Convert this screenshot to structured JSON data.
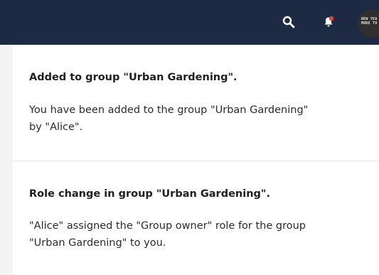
{
  "header": {
    "search_icon": "search-icon",
    "notification_icon": "bell-icon",
    "notification_dot_color": "#e0473c",
    "avatar_text": "NEW YEA\nMORE TO"
  },
  "notifications": [
    {
      "title": "Added to group \"Urban Gardening\".",
      "body": "You have been added to the group \"Urban Gardening\" by \"Alice\"."
    },
    {
      "title": "Role change in group \"Urban Gardening\".",
      "body": "\"Alice\" assigned the \"Group owner\" role for the group \"Urban Gardening\" to you."
    }
  ],
  "colors": {
    "header_bg": "#1e2a44",
    "page_bg": "#f3f4f6",
    "card_bg": "#ffffff"
  }
}
